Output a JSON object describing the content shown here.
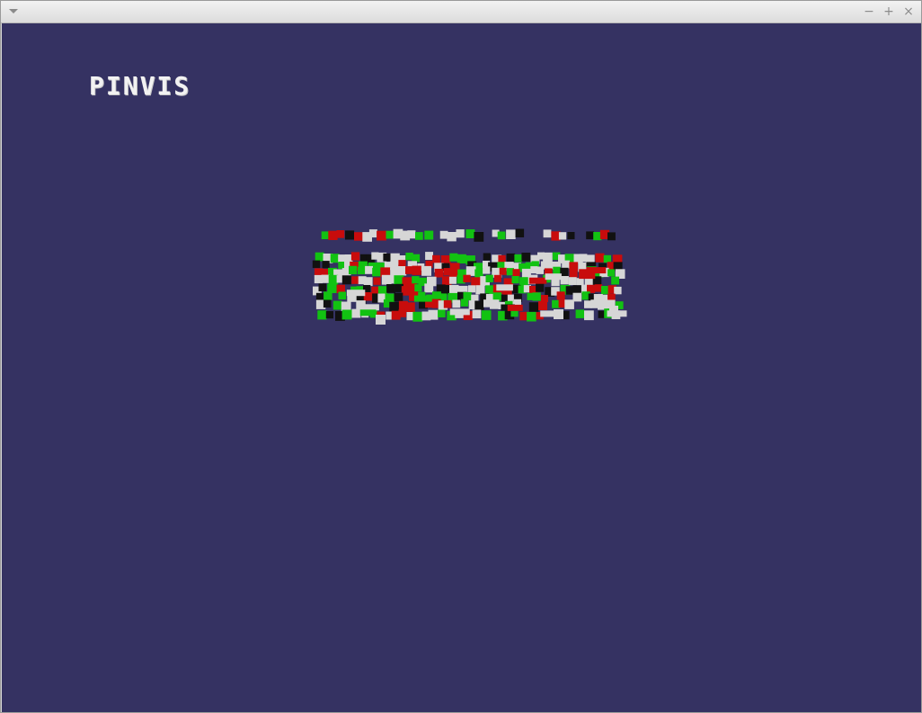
{
  "window": {
    "menu_icon": "chevron-down-icon",
    "buttons": {
      "minimize": "−",
      "maximize": "+",
      "close": "×"
    }
  },
  "app": {
    "title": "PINVIS"
  },
  "colors": {
    "background": "#353262",
    "pin_white": "#d6d6d6",
    "pin_green": "#12c212",
    "pin_red": "#c80c0c",
    "pin_black": "#111111"
  }
}
